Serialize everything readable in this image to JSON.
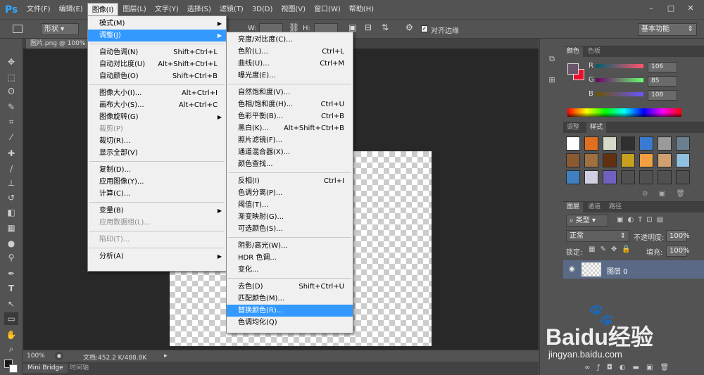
{
  "app": {
    "logo": "Ps"
  },
  "menubar": [
    "文件(F)",
    "编辑(E)",
    "图像(I)",
    "图层(L)",
    "文字(Y)",
    "选择(S)",
    "滤镜(T)",
    "3D(D)",
    "视图(V)",
    "窗口(W)",
    "帮助(H)"
  ],
  "window_controls": [
    "–",
    "□",
    "✕"
  ],
  "options": {
    "shape_mode": "形状",
    "w_label": "W:",
    "h_label": "H:",
    "align_edges": "对齐边缘",
    "workspace": "基本功能"
  },
  "document": {
    "tab": "图片.png @ 100%"
  },
  "status": {
    "zoom": "100%",
    "doc_info": "文档:452.2 K/488.8K"
  },
  "bottom_tabs": [
    "Mini Bridge",
    "时间轴"
  ],
  "image_menu": {
    "items": [
      {
        "label": "模式(M)",
        "shortcut": "",
        "submenu": true,
        "disabled": false
      },
      {
        "label": "调整(J)",
        "shortcut": "",
        "submenu": true,
        "disabled": false,
        "highlighted": true
      },
      {
        "label": "自动色调(N)",
        "shortcut": "Shift+Ctrl+L"
      },
      {
        "label": "自动对比度(U)",
        "shortcut": "Alt+Shift+Ctrl+L"
      },
      {
        "label": "自动颜色(O)",
        "shortcut": "Shift+Ctrl+B"
      },
      {
        "label": "图像大小(I)...",
        "shortcut": "Alt+Ctrl+I"
      },
      {
        "label": "画布大小(S)...",
        "shortcut": "Alt+Ctrl+C"
      },
      {
        "label": "图像旋转(G)",
        "shortcut": "",
        "submenu": true
      },
      {
        "label": "裁剪(P)",
        "shortcut": "",
        "disabled": true
      },
      {
        "label": "裁切(R)...",
        "shortcut": ""
      },
      {
        "label": "显示全部(V)",
        "shortcut": ""
      },
      {
        "label": "复制(D)...",
        "shortcut": ""
      },
      {
        "label": "应用图像(Y)...",
        "shortcut": ""
      },
      {
        "label": "计算(C)...",
        "shortcut": ""
      },
      {
        "label": "变量(B)",
        "shortcut": "",
        "submenu": true
      },
      {
        "label": "应用数据组(L)...",
        "shortcut": "",
        "disabled": true
      },
      {
        "label": "陷印(T)...",
        "shortcut": "",
        "disabled": true
      },
      {
        "label": "分析(A)",
        "shortcut": "",
        "submenu": true
      }
    ]
  },
  "adjust_menu": {
    "items": [
      {
        "label": "亮度/对比度(C)...",
        "shortcut": ""
      },
      {
        "label": "色阶(L)...",
        "shortcut": "Ctrl+L"
      },
      {
        "label": "曲线(U)...",
        "shortcut": "Ctrl+M"
      },
      {
        "label": "曝光度(E)...",
        "shortcut": ""
      },
      {
        "label": "自然饱和度(V)...",
        "shortcut": ""
      },
      {
        "label": "色相/饱和度(H)...",
        "shortcut": "Ctrl+U"
      },
      {
        "label": "色彩平衡(B)...",
        "shortcut": "Ctrl+B"
      },
      {
        "label": "黑白(K)...",
        "shortcut": "Alt+Shift+Ctrl+B"
      },
      {
        "label": "照片滤镜(F)...",
        "shortcut": ""
      },
      {
        "label": "通道混合器(X)...",
        "shortcut": ""
      },
      {
        "label": "颜色查找...",
        "shortcut": ""
      },
      {
        "label": "反相(I)",
        "shortcut": "Ctrl+I"
      },
      {
        "label": "色调分离(P)...",
        "shortcut": ""
      },
      {
        "label": "阈值(T)...",
        "shortcut": ""
      },
      {
        "label": "渐变映射(G)...",
        "shortcut": ""
      },
      {
        "label": "可选颜色(S)...",
        "shortcut": ""
      },
      {
        "label": "阴影/高光(W)...",
        "shortcut": ""
      },
      {
        "label": "HDR 色调...",
        "shortcut": ""
      },
      {
        "label": "变化...",
        "shortcut": ""
      },
      {
        "label": "去色(D)",
        "shortcut": "Shift+Ctrl+U"
      },
      {
        "label": "匹配颜色(M)...",
        "shortcut": ""
      },
      {
        "label": "替换颜色(R)...",
        "shortcut": "",
        "highlighted": true
      },
      {
        "label": "色调均化(Q)",
        "shortcut": ""
      }
    ]
  },
  "color_panel": {
    "tabs": [
      "颜色",
      "色板"
    ],
    "r_label": "R",
    "g_label": "G",
    "b_label": "B",
    "r": "106",
    "g": "85",
    "b": "108",
    "foreground": "#6a556c",
    "background": "#e8102a"
  },
  "style_panel": {
    "tabs": [
      "调整",
      "样式"
    ]
  },
  "layers_panel": {
    "tabs": [
      "图层",
      "通道",
      "路径"
    ],
    "filter_kind": "类型",
    "blend_mode": "正常",
    "opacity_label": "不透明度:",
    "opacity": "100%",
    "lock_label": "锁定:",
    "fill_label": "填充:",
    "fill": "100%",
    "layer_name": "图层 0"
  },
  "watermark": {
    "brand": "Baidu经验",
    "url": "jingyan.baidu.com"
  }
}
